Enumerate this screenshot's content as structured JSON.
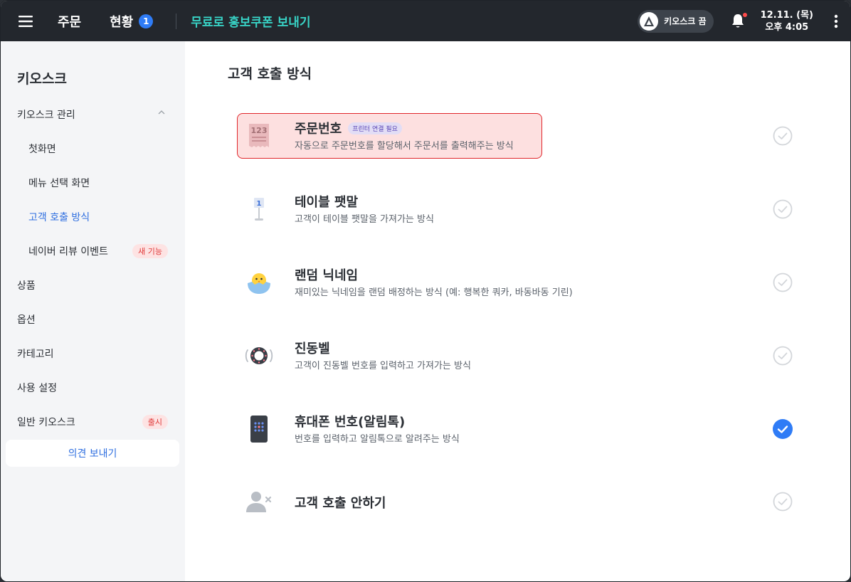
{
  "topbar": {
    "nav": [
      {
        "label": "주문"
      },
      {
        "label": "현황",
        "badge": "1"
      }
    ],
    "promo": "무료로 홍보쿠폰 보내기",
    "kiosk_toggle": "키오스크 끔",
    "date": "12.11. (목)",
    "time": "오후 4:05"
  },
  "sidebar": {
    "title": "키오스크",
    "items": [
      {
        "label": "키오스크 관리"
      },
      {
        "label": "첫화면"
      },
      {
        "label": "메뉴 선택 화면"
      },
      {
        "label": "고객 호출 방식"
      },
      {
        "label": "네이버 리뷰 이벤트",
        "tag": "새 기능"
      },
      {
        "label": "상품"
      },
      {
        "label": "옵션"
      },
      {
        "label": "카테고리"
      },
      {
        "label": "사용 설정"
      },
      {
        "label": "일반 키오스크",
        "tag": "출시"
      }
    ],
    "feedback": "의견 보내기"
  },
  "main": {
    "title": "고객 호출 방식",
    "options": [
      {
        "name": "주문번호",
        "tag": "프린터 연결 필요",
        "desc": "자동으로 주문번호를 할당해서 주문서를 출력해주는 방식",
        "icon": "receipt-icon",
        "selected": false
      },
      {
        "name": "테이블 팻말",
        "desc": "고객이 테이블 팻말을 가져가는 방식",
        "icon": "table-sign-icon",
        "selected": false
      },
      {
        "name": "랜덤 닉네임",
        "desc": "재미있는 닉네임을 랜덤 배정하는 방식 (예: 행복한 쿼카, 바동바동 기린)",
        "icon": "chick-icon",
        "selected": false
      },
      {
        "name": "진동벨",
        "desc": "고객이 진동벨 번호를 입력하고 가져가는 방식",
        "icon": "vibrating-bell-icon",
        "selected": false
      },
      {
        "name": "휴대폰 번호(알림톡)",
        "desc": "번호를 입력하고 알림톡으로 알려주는 방식",
        "icon": "phone-icon",
        "selected": true
      },
      {
        "name": "고객 호출 안하기",
        "desc": "",
        "icon": "user-remove-icon",
        "selected": false
      }
    ]
  },
  "colors": {
    "topbar": "#23272d",
    "accent": "#2f7cf6",
    "promo": "#38d3c6",
    "sidebar_bg": "#f4f5f7",
    "highlight_border": "#e0262b",
    "highlight_bg": "#fde0e0"
  }
}
